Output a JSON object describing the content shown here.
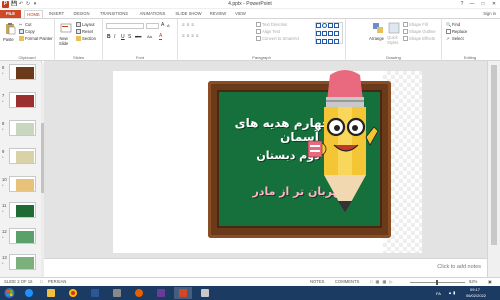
{
  "window": {
    "title": "4.pptx - PowerPoint",
    "app_icon_letter": "P",
    "minimize_glyph": "?",
    "restore_glyph": "□",
    "close_glyph": "✕"
  },
  "quick_access": [
    "save-icon",
    "undo-icon",
    "redo-icon",
    "customize-icon"
  ],
  "tabs": [
    {
      "label": "FILE"
    },
    {
      "label": "HOME"
    },
    {
      "label": "INSERT"
    },
    {
      "label": "DESIGN"
    },
    {
      "label": "TRANSITIONS"
    },
    {
      "label": "ANIMATIONS"
    },
    {
      "label": "SLIDE SHOW"
    },
    {
      "label": "REVIEW"
    },
    {
      "label": "VIEW"
    }
  ],
  "sign_in": "Sign in",
  "ribbon": {
    "clipboard": {
      "paste": "Paste",
      "cut": "Cut",
      "copy": "Copy",
      "format_painter": "Format Painter",
      "label": "Clipboard"
    },
    "slides": {
      "new_slide": "New\nSlide",
      "layout": "Layout",
      "reset": "Reset",
      "section": "Section",
      "label": "Slides"
    },
    "font": {
      "label": "Font",
      "bold": "B",
      "italic": "I",
      "underline": "U",
      "shadow": "S",
      "strike": "abc",
      "case": "Aa"
    },
    "paragraph": {
      "text_direction": "Text Direction",
      "align_text": "Align Text",
      "convert_smartart": "Convert to SmartArt",
      "label": "Paragraph"
    },
    "drawing": {
      "arrange": "Arrange",
      "quick_styles": "Quick\nStyles",
      "shape_fill": "Shape Fill",
      "shape_outline": "Shape Outline",
      "shape_effects": "Shape Effects",
      "label": "Drawing"
    },
    "editing": {
      "find": "Find",
      "replace": "Replace",
      "select": "Select",
      "label": "Editing"
    }
  },
  "slides_panel": [
    {
      "num": "6",
      "star": "*",
      "selected": false
    },
    {
      "num": "7",
      "star": "*",
      "selected": false
    },
    {
      "num": "8",
      "star": "*",
      "selected": false
    },
    {
      "num": "9",
      "star": "*",
      "selected": false
    },
    {
      "num": "10",
      "star": "*",
      "selected": false
    },
    {
      "num": "11",
      "star": "*",
      "selected": false
    },
    {
      "num": "12",
      "star": "*",
      "selected": false
    },
    {
      "num": "13",
      "star": "*",
      "selected": false
    }
  ],
  "slide": {
    "line1": "درس چهارم هدیه های آسمان",
    "line2": "پایه دوم دبستان",
    "line3": "مهربان تر از مادر"
  },
  "notes_placeholder": "Click to add notes",
  "status": {
    "slide_of": "SLIDE 2 OF 16",
    "language": "PERSIAN",
    "notes": "NOTES",
    "comments": "COMMENTS",
    "zoom": "62%"
  },
  "tray": {
    "lang": "FA",
    "time": "09:17",
    "date": "06/02/2022"
  },
  "colors": {
    "accent": "#c43e1c",
    "taskbar": "#1c3b63",
    "chalkboard": "#16703b",
    "frame": "#6b3a1a"
  }
}
